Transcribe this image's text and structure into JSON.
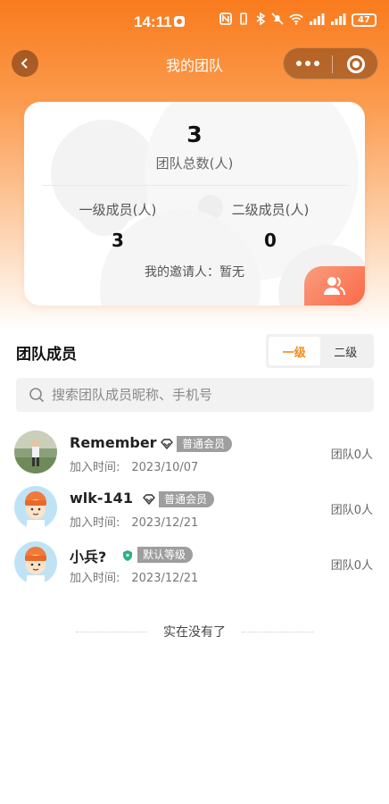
{
  "status_bar": {
    "time": "14:11",
    "battery": "47"
  },
  "nav": {
    "title": "我的团队"
  },
  "stats": {
    "total": "3",
    "total_label": "团队总数(人)",
    "level1_label": "一级成员(人)",
    "level1_value": "3",
    "level2_label": "二级成员(人)",
    "level2_value": "0",
    "inviter": "我的邀请人：暂无"
  },
  "members_section": {
    "title": "团队成员",
    "tabs": [
      "一级",
      "二级"
    ],
    "active_tab": "一级",
    "search_placeholder": "搜索团队成员昵称、手机号"
  },
  "members": [
    {
      "name": "Remember",
      "badge": "普通会员",
      "badge_icon": "diamond-icon",
      "join_date": "加入时间:　2023/10/07",
      "team_count": "团队0人",
      "avatar": "photo-avatar"
    },
    {
      "name": "wlk-141",
      "badge": "普通会员",
      "badge_icon": "diamond-icon",
      "join_date": "加入时间:　2023/12/21",
      "team_count": "团队0人",
      "avatar": "cartoon-avatar"
    },
    {
      "name": "小兵?",
      "badge": "默认等级",
      "badge_icon": "shield-icon",
      "join_date": "加入时间:　2023/12/21",
      "team_count": "团队0人",
      "avatar": "cartoon-avatar"
    }
  ],
  "footer": {
    "end_text": "实在没有了"
  },
  "colors": {
    "brand": "#f97b1e",
    "active_tab": "#f28a1c",
    "badge_bg": "#9e9e9e"
  }
}
